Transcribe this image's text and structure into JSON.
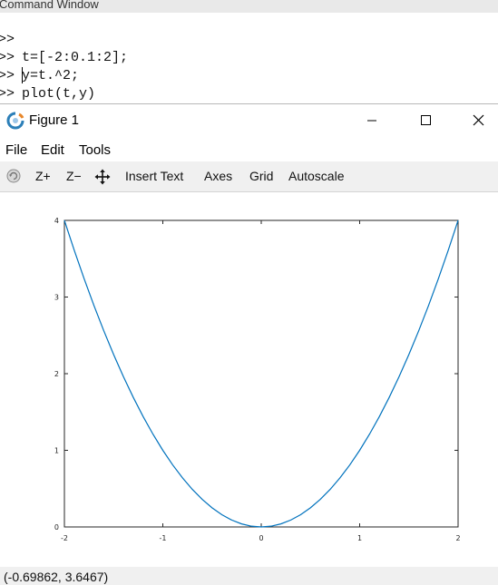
{
  "command_window": {
    "title": "Command Window",
    "lines": [
      {
        "prompt": ">>",
        "code": "t=[-2:0.1:2];"
      },
      {
        "prompt": ">>",
        "code": "y=t.^2;"
      },
      {
        "prompt": ">>",
        "code": "plot(t,y)"
      },
      {
        "prompt": ">>",
        "code": ""
      }
    ]
  },
  "figure": {
    "title": "Figure 1",
    "icons": {
      "app": "octave-logo-icon",
      "minimize": "minimize-icon",
      "maximize": "maximize-icon",
      "close": "close-icon",
      "rotate": "rotate-icon",
      "pan": "pan-icon"
    },
    "menu": [
      "File",
      "Edit",
      "Tools"
    ],
    "toolbar": {
      "zoom_in": "Z+",
      "zoom_out": "Z−",
      "insert_text": "Insert Text",
      "axes": "Axes",
      "grid": "Grid",
      "autoscale": "Autoscale"
    },
    "status": "(-0.69862, 3.6467)",
    "colors": {
      "line": "#0072bd",
      "toolbar": "#f0f0f0"
    }
  },
  "chart_data": {
    "type": "line",
    "x": [
      -2,
      -1.9,
      -1.8,
      -1.7,
      -1.6,
      -1.5,
      -1.4,
      -1.3,
      -1.2,
      -1.1,
      -1,
      -0.9,
      -0.8,
      -0.7,
      -0.6,
      -0.5,
      -0.4,
      -0.3,
      -0.2,
      -0.1,
      0,
      0.1,
      0.2,
      0.3,
      0.4,
      0.5,
      0.6,
      0.7,
      0.8,
      0.9,
      1,
      1.1,
      1.2,
      1.3,
      1.4,
      1.5,
      1.6,
      1.7,
      1.8,
      1.9,
      2
    ],
    "series": [
      {
        "values": [
          4,
          3.61,
          3.24,
          2.89,
          2.56,
          2.25,
          1.96,
          1.69,
          1.44,
          1.21,
          1,
          0.81,
          0.64,
          0.49,
          0.36,
          0.25,
          0.16,
          0.09,
          0.04,
          0.01,
          0,
          0.01,
          0.04,
          0.09,
          0.16,
          0.25,
          0.36,
          0.49,
          0.64,
          0.81,
          1,
          1.21,
          1.44,
          1.69,
          1.96,
          2.25,
          2.56,
          2.89,
          3.24,
          3.61,
          4
        ]
      }
    ],
    "xlim": [
      -2,
      2
    ],
    "ylim": [
      0,
      4
    ],
    "xticks": [
      -2,
      -1,
      0,
      1,
      2
    ],
    "yticks": [
      0,
      1,
      2,
      3,
      4
    ],
    "xtick_labels": [
      "-2",
      "-1",
      "0",
      "1",
      "2"
    ],
    "ytick_labels": [
      "0",
      "1",
      "2",
      "3",
      "4"
    ],
    "title": "",
    "xlabel": "",
    "ylabel": "",
    "grid": false
  }
}
